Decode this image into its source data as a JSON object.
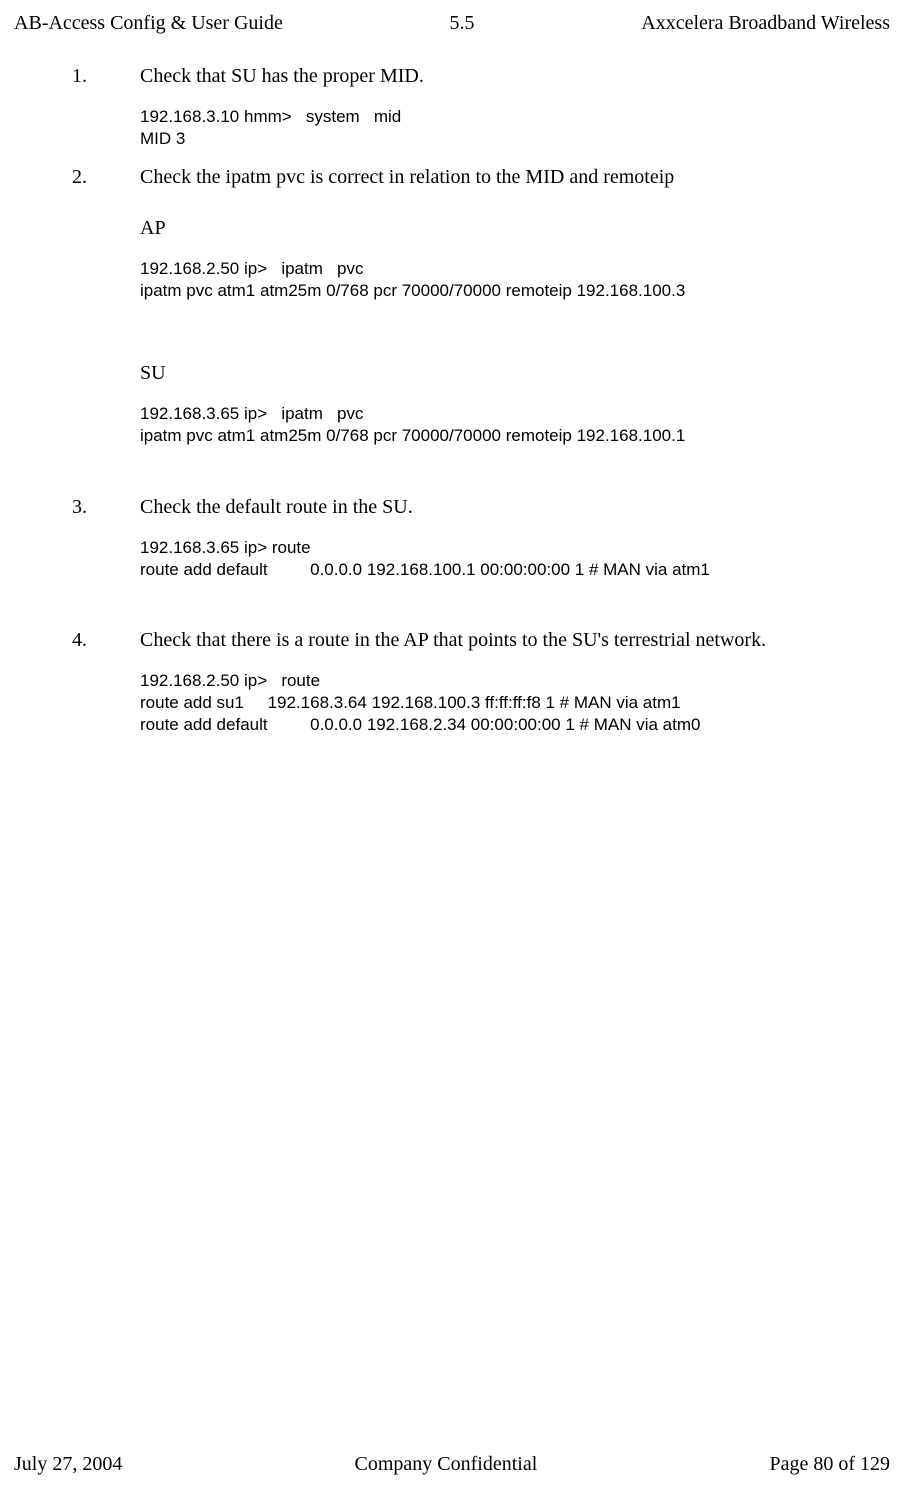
{
  "header": {
    "left": "AB-Access Config & User Guide",
    "center": "5.5",
    "right": "Axxcelera Broadband Wireless"
  },
  "items": [
    {
      "num": "1.",
      "text": "Check that SU has the proper MID.",
      "blocks": [
        {
          "type": "code",
          "text": "192.168.3.10 hmm>   system   mid\nMID 3"
        }
      ]
    },
    {
      "num": "2.",
      "text": "Check the ipatm pvc is correct in relation to the MID and remoteip",
      "blocks": [
        {
          "type": "subhead",
          "text": "AP"
        },
        {
          "type": "code",
          "text": "192.168.2.50 ip>   ipatm   pvc\nipatm pvc atm1 atm25m 0/768 pcr 70000/70000 remoteip 192.168.100.3"
        },
        {
          "type": "spacer-med"
        },
        {
          "type": "subhead",
          "text": "SU"
        },
        {
          "type": "code",
          "text": "192.168.3.65 ip>   ipatm   pvc\nipatm pvc atm1 atm25m 0/768 pcr 70000/70000 remoteip 192.168.100.1"
        },
        {
          "type": "spacer-med"
        }
      ]
    },
    {
      "num": "3.",
      "text": "Check the default route in the SU.",
      "blocks": [
        {
          "type": "code",
          "text": "192.168.3.65 ip> route\nroute add default         0.0.0.0 192.168.100.1 00:00:00:00 1 # MAN via atm1"
        },
        {
          "type": "spacer-med"
        }
      ]
    },
    {
      "num": "4.",
      "text": "Check that there is a route in the AP that points to the SU's terrestrial network.",
      "blocks": [
        {
          "type": "code",
          "text": "192.168.2.50 ip>   route\nroute add su1     192.168.3.64 192.168.100.3 ff:ff:ff:f8 1 # MAN via atm1\nroute add default         0.0.0.0 192.168.2.34 00:00:00:00 1 # MAN via atm0"
        }
      ]
    }
  ],
  "footer": {
    "left": "July 27, 2004",
    "center": "Company Confidential",
    "right": "Page 80 of 129"
  }
}
